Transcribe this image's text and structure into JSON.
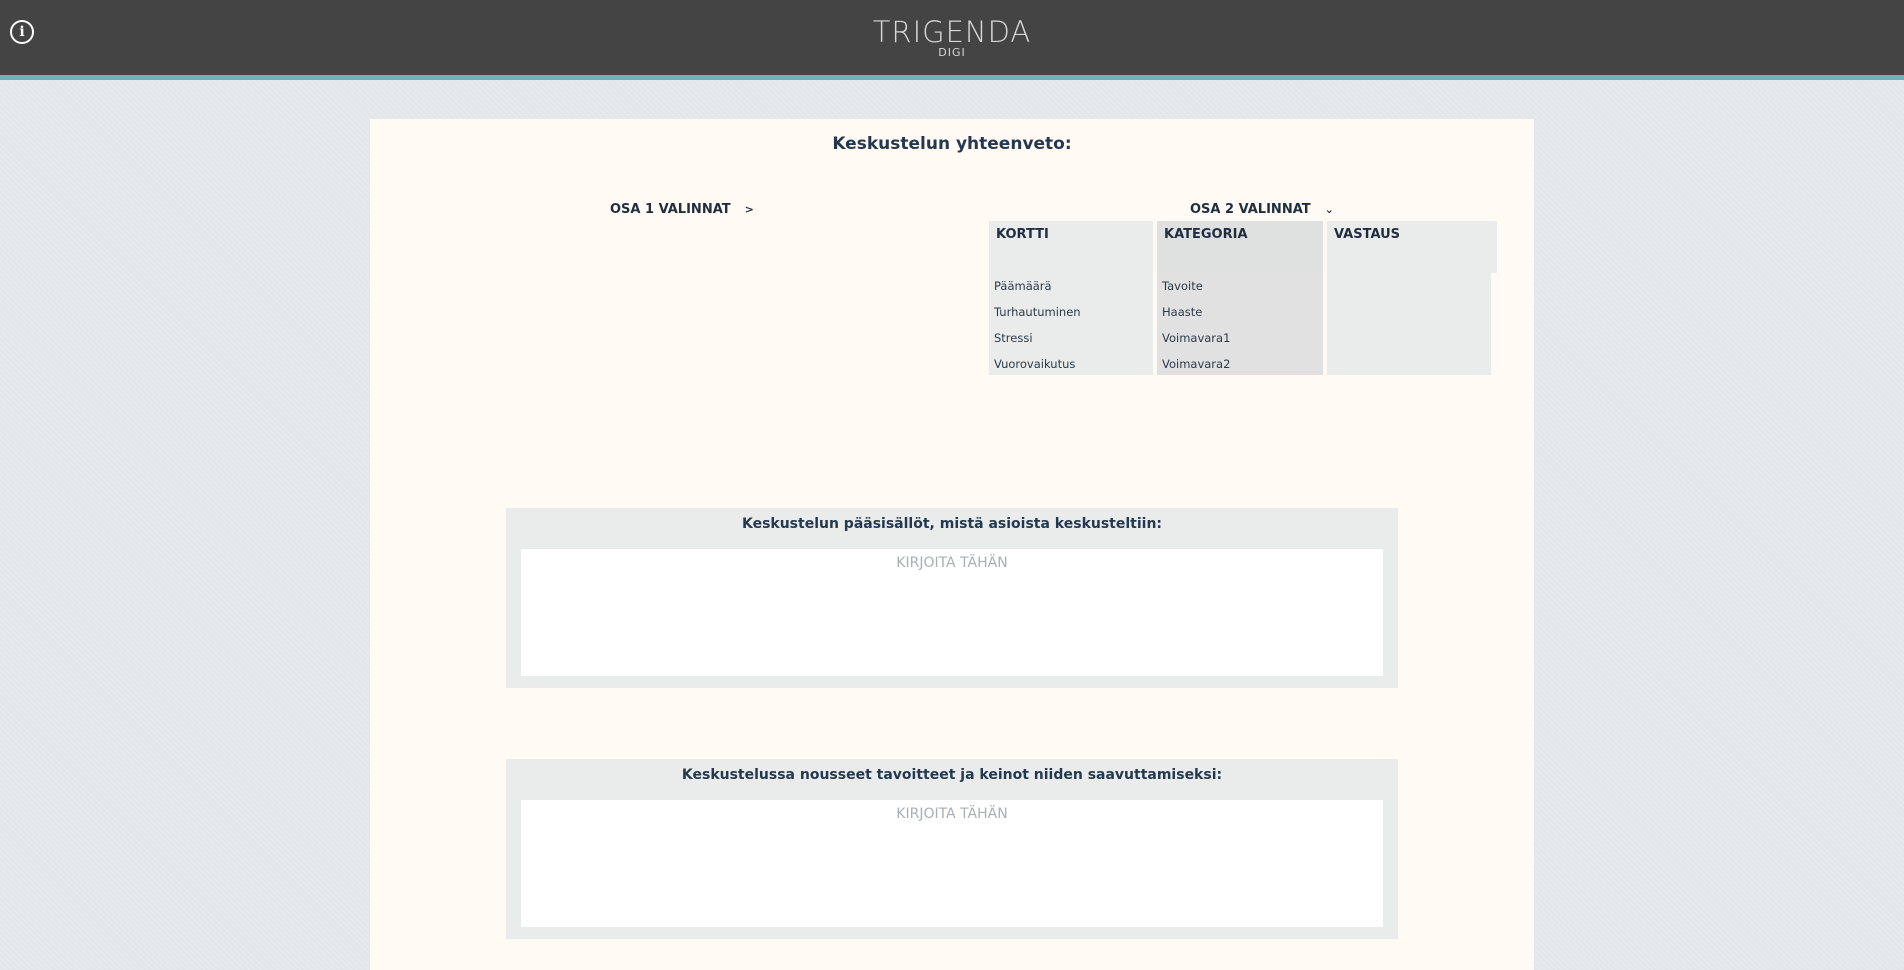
{
  "header": {
    "info_icon": "info-circle-icon",
    "info_glyph": "i",
    "logo_main": "TRIGENDA",
    "logo_sub": "DIGI",
    "bar_color": "#444444",
    "accent_color": "#6fb1b8"
  },
  "summary": {
    "title": "Keskustelun yhteenveto:",
    "part1_toggle": {
      "label": "OSA 1 VALINNAT",
      "chevron": ">",
      "expanded": false
    },
    "part2_toggle": {
      "label": "OSA 2 VALINNAT",
      "chevron": "⌄",
      "expanded": true
    },
    "table": {
      "columns": [
        {
          "header": "KORTTI",
          "items": [
            "Päämäärä",
            "Turhautuminen",
            "Stressi",
            "Vuorovaikutus"
          ]
        },
        {
          "header": "KATEGORIA",
          "items": [
            "Tavoite",
            "Haaste",
            "Voimavara1",
            "Voimavara2"
          ]
        },
        {
          "header": "VASTAUS",
          "items": []
        }
      ]
    }
  },
  "sections": [
    {
      "title": "Keskustelun pääsisällöt, mistä asioista keskusteltiin:",
      "value": "",
      "placeholder": "KIRJOITA TÄHÄN"
    },
    {
      "title": "Keskustelussa nousseet tavoitteet ja keinot niiden saavuttamiseksi:",
      "value": "",
      "placeholder": "KIRJOITA TÄHÄN"
    }
  ]
}
